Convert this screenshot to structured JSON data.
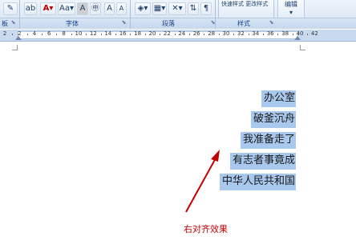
{
  "ribbon": {
    "font_group_label": "字体",
    "paragraph_group_label": "段落",
    "styles_group_label": "样式",
    "left_cut_label": "板",
    "styles_text": "快速样式 更改样式",
    "edit_label": "编辑",
    "font_size_label": "Aa",
    "font_color_label": "A",
    "char_shading_label": "A",
    "enclose_char_label": "㊥",
    "grow_font_label": "A",
    "shrink_font_label": "A"
  },
  "ruler": {
    "ticks": [
      "2",
      "2",
      "4",
      "6",
      "8",
      "10",
      "12",
      "14",
      "16",
      "18",
      "20",
      "22",
      "24",
      "26",
      "28",
      "30",
      "32",
      "34",
      "36",
      "38",
      "40",
      "42"
    ]
  },
  "document": {
    "lines": [
      "办公室",
      "破釜沉舟",
      "我准备走了",
      "有志者事竟成",
      "中华人民共和国"
    ]
  },
  "annotation": {
    "caption": "右对齐效果",
    "color": "#c00000"
  },
  "colors": {
    "selection": "#a9c8ee",
    "ribbon_label": "#15428b"
  }
}
